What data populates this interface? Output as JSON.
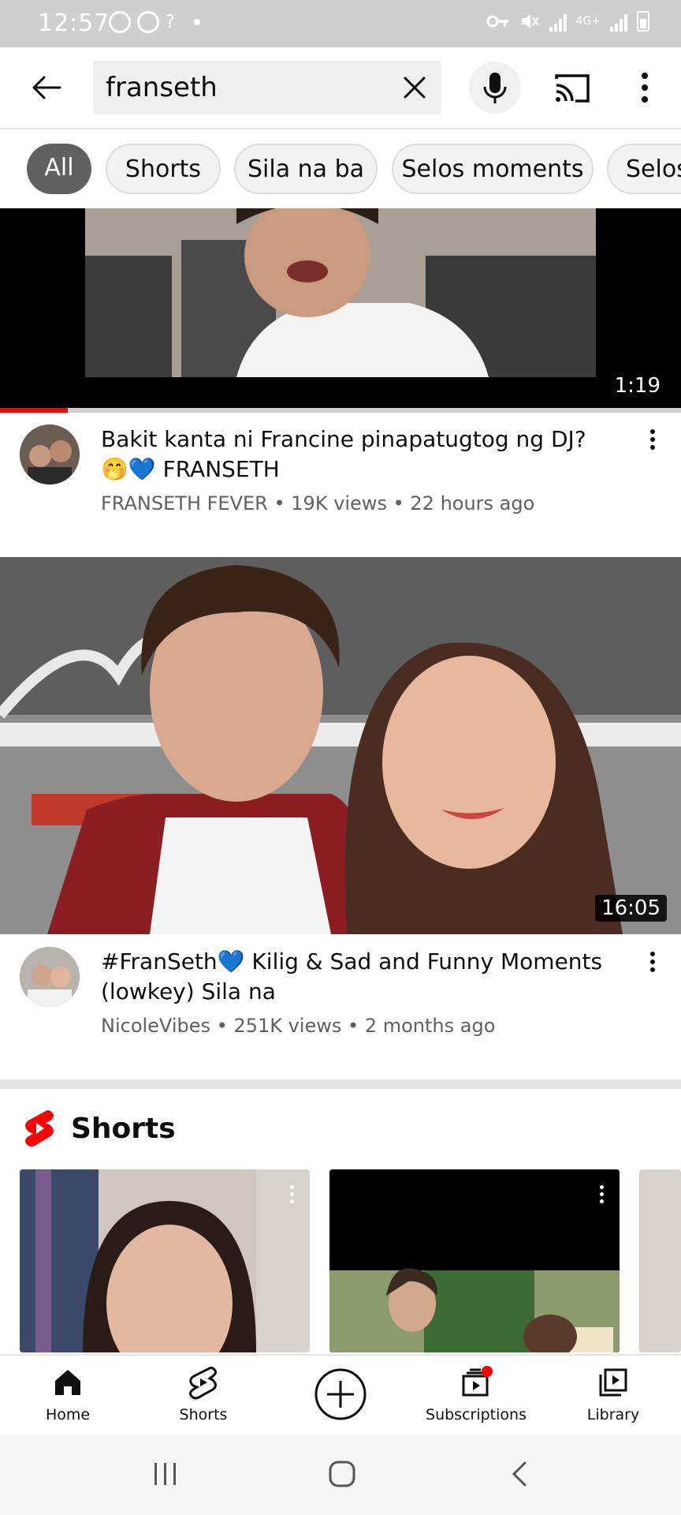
{
  "status_bar": {
    "time": "12:57",
    "network": "4G+",
    "battery_level": "7"
  },
  "search": {
    "query": "franseth"
  },
  "chips": [
    "All",
    "Shorts",
    "Sila na ba",
    "Selos moments",
    "Selos"
  ],
  "videos": [
    {
      "title": "Bakit kanta ni Francine pinapatugtog ng DJ? 🤭💙 FRANSETH",
      "channel": "FRANSETH FEVER",
      "views": "19K views",
      "age": "22 hours ago",
      "duration": "1:19",
      "watched_fraction": 0.1
    },
    {
      "title": "#FranSeth💙 Kilig & Sad and Funny Moments (lowkey) Sila na",
      "channel": "NicoleVibes",
      "views": "251K views",
      "age": "2 months ago",
      "duration": "16:05"
    }
  ],
  "shorts_section": {
    "title": "Shorts"
  },
  "bottom_nav": [
    {
      "label": "Home",
      "icon": "home-icon"
    },
    {
      "label": "Shorts",
      "icon": "shorts-icon"
    },
    {
      "label": "",
      "icon": "create-icon"
    },
    {
      "label": "Subscriptions",
      "icon": "subscriptions-icon"
    },
    {
      "label": "Library",
      "icon": "library-icon"
    }
  ],
  "colors": {
    "accent_red": "#ff0000",
    "chip_active": "#606060",
    "meta_text": "#606060"
  }
}
